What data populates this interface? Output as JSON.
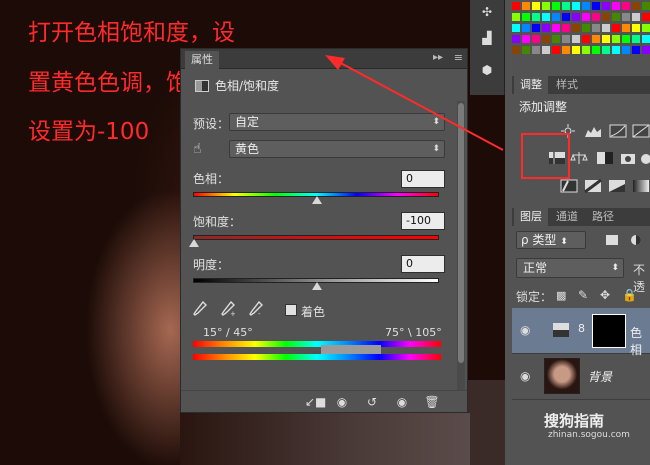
{
  "annotation": {
    "line1": "打开色相饱和度，设",
    "line2": "置黄色色调，饱和度",
    "line3": "设置为-100"
  },
  "properties": {
    "tab_label": "属性",
    "panel_title": "色相/饱和度",
    "preset_label": "预设：",
    "preset_value": "自定",
    "channel_value": "黄色",
    "hue_label": "色相：",
    "hue_value": "0",
    "saturation_label": "饱和度：",
    "saturation_value": "-100",
    "lightness_label": "明度：",
    "lightness_value": "0",
    "colorize_label": "着色",
    "range_left": "15° / 45°",
    "range_right": "75° \\ 105°"
  },
  "adjustments": {
    "tab_adjust": "调整",
    "tab_style": "样式",
    "title": "添加调整"
  },
  "layers": {
    "tab_layers": "图层",
    "tab_channels": "通道",
    "tab_paths": "路径",
    "filter_label": "ρ 类型",
    "blend_mode": "正常",
    "opacity_label": "不透",
    "lock_label": "锁定：",
    "layer1_name": "色相",
    "layer2_name": "背景"
  },
  "watermark": {
    "brand": "搜狗指南",
    "url": "zhinan.sogou.com"
  },
  "colors": {
    "annotation_red": "#ff2a2a",
    "panel_bg": "#535353",
    "selected_layer": "#6b7b92"
  }
}
